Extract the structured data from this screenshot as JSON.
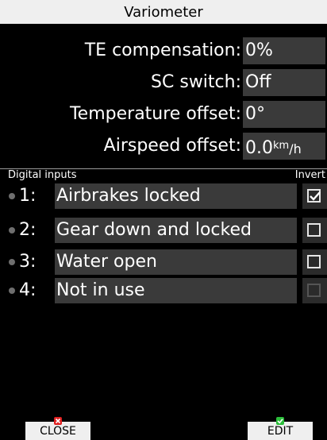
{
  "title": "Variometer",
  "fields": [
    {
      "label": "TE compensation:",
      "value": "0%"
    },
    {
      "label": "SC switch:",
      "value": "Off"
    },
    {
      "label": "Temperature offset:",
      "value": "0°"
    },
    {
      "label": "Airspeed offset:",
      "value": "0.0",
      "unit_num": "km",
      "unit_sep": "/",
      "unit_den": "h"
    }
  ],
  "digital_inputs": {
    "header": "Digital inputs",
    "invert_header": "Invert",
    "items": [
      {
        "num": "1:",
        "value": "Airbrakes locked",
        "inverted": true,
        "enabled": true
      },
      {
        "num": "2:",
        "value": "Gear down and locked",
        "inverted": false,
        "enabled": true
      },
      {
        "num": "3:",
        "value": "Water open",
        "inverted": false,
        "enabled": true
      },
      {
        "num": "4:",
        "value": "Not in use",
        "inverted": false,
        "enabled": false
      }
    ]
  },
  "buttons": {
    "close": {
      "label": "CLOSE",
      "icon": "red-x-icon",
      "icon_color": "#e02020"
    },
    "edit": {
      "label": "EDIT",
      "icon": "green-check-icon",
      "icon_color": "#2bbd3a"
    }
  }
}
